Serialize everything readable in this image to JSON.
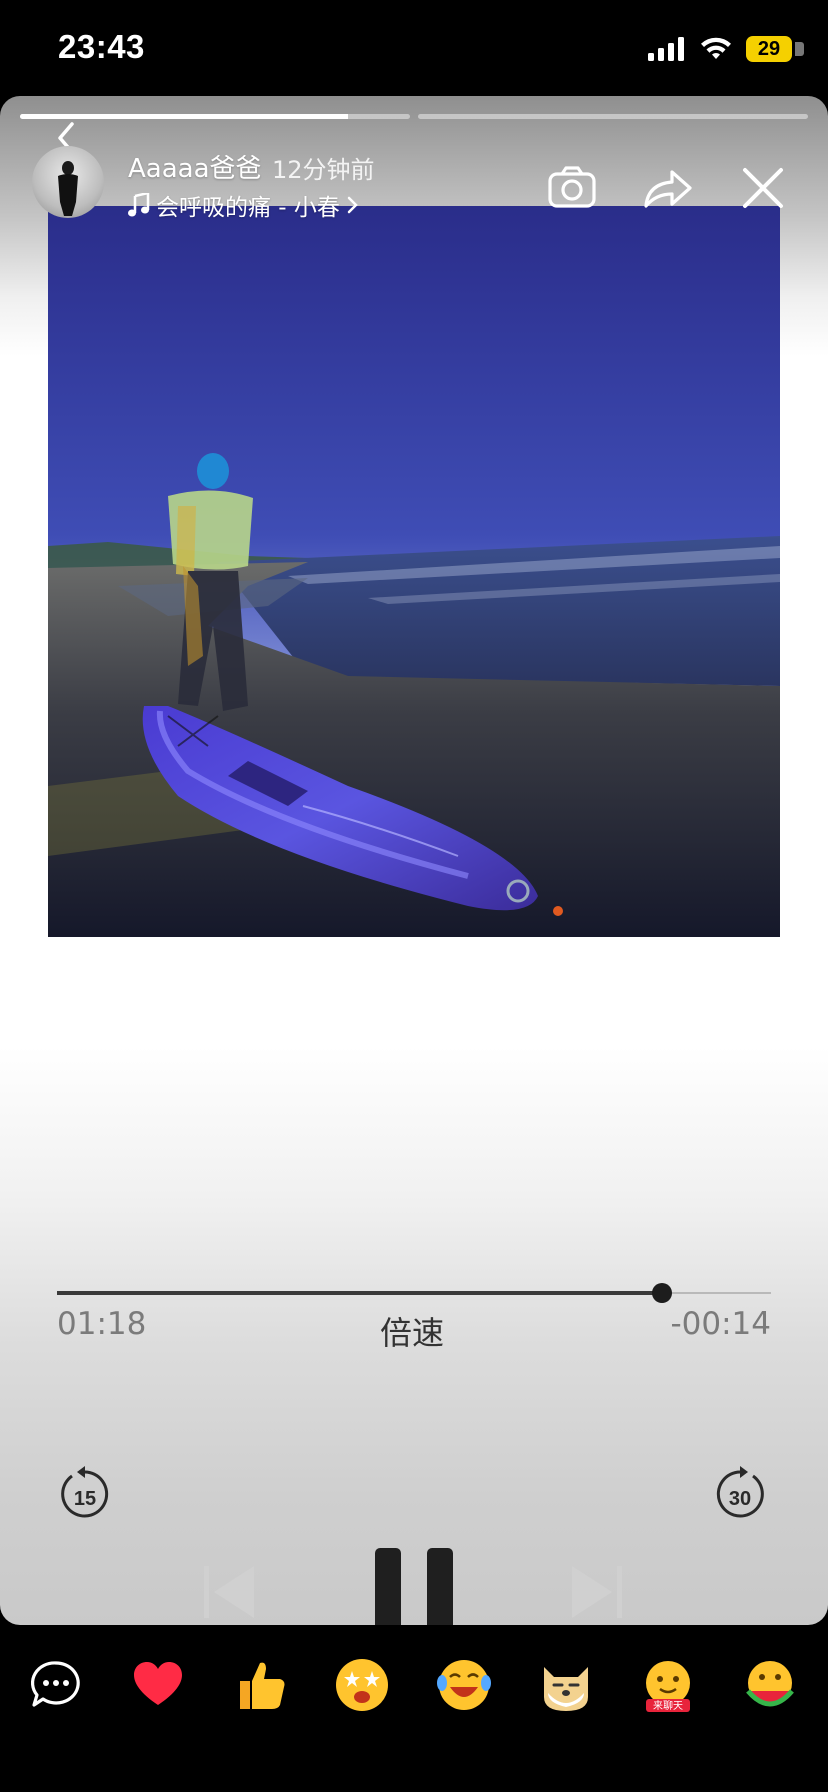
{
  "status_bar": {
    "time": "23:43",
    "battery_level": "29",
    "battery_color": "#f5d000"
  },
  "story": {
    "segments": [
      {
        "progress": 0.84
      },
      {
        "progress": 0.0
      }
    ],
    "user_name": "Aaaaa爸爸",
    "post_time": "12分钟前",
    "music_note_icon": "music-note-icon",
    "music_title": "会呼吸的痛 - 小春",
    "actions": {
      "camera_icon": "camera-icon",
      "share_icon": "share-icon",
      "close_icon": "close-icon"
    },
    "photo_alt_icon": "beach-paddleboard-photo"
  },
  "player": {
    "progress": 0.848,
    "elapsed": "01:18",
    "speed_label": "倍速",
    "remaining": "-00:14",
    "controls": {
      "rewind_icon": "rewind-15-icon",
      "rewind_text": "15",
      "prev_icon": "previous-track-icon",
      "pause_icon": "pause-icon",
      "next_icon": "next-track-icon",
      "forward_icon": "forward-30-icon",
      "forward_text": "30"
    }
  },
  "reactions": {
    "comment_icon": "comment-bubble-icon",
    "heart_icon": "heart-icon",
    "heart_color": "#ff2b45",
    "items": [
      {
        "icon": "thumbs-up-emoji"
      },
      {
        "icon": "star-eyes-emoji"
      },
      {
        "icon": "laughing-tears-emoji"
      },
      {
        "icon": "doge-emoji"
      },
      {
        "icon": "hugging-chat-emoji",
        "badge": "来聊天"
      },
      {
        "icon": "watermelon-emoji"
      }
    ]
  }
}
